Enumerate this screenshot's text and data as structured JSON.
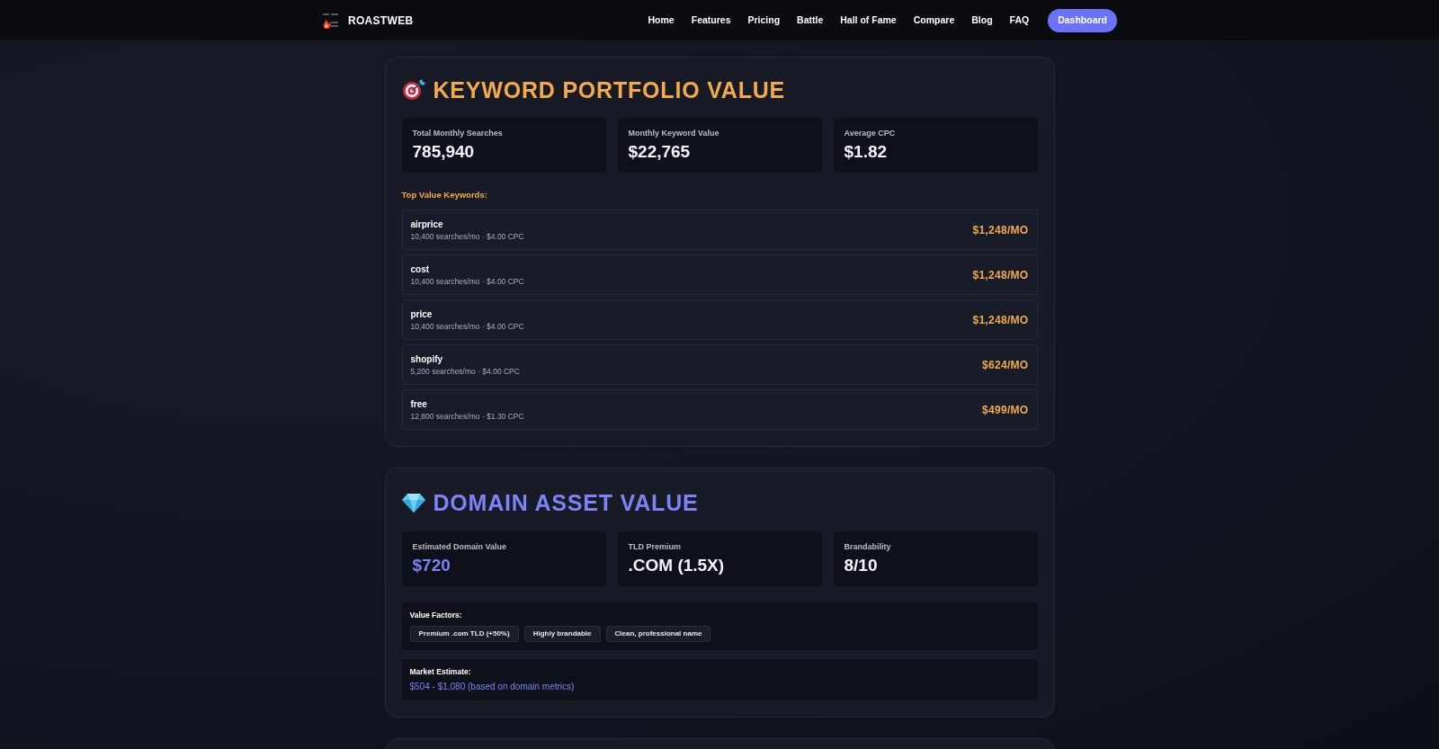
{
  "nav": {
    "brand": "ROASTWEB",
    "links": [
      "Home",
      "Features",
      "Pricing",
      "Battle",
      "Hall of Fame",
      "Compare",
      "Blog",
      "FAQ"
    ],
    "cta": "Dashboard"
  },
  "keyword_section": {
    "title": "KEYWORD PORTFOLIO VALUE",
    "stats": [
      {
        "label": "Total Monthly Searches",
        "value": "785,940"
      },
      {
        "label": "Monthly Keyword Value",
        "value": "$22,765"
      },
      {
        "label": "Average CPC",
        "value": "$1.82"
      }
    ],
    "list_title": "Top Value Keywords:",
    "keywords": [
      {
        "keyword": "airprice",
        "details": "10,400 searches/mo · $4.00 CPC",
        "value": "$1,248/MO"
      },
      {
        "keyword": "cost",
        "details": "10,400 searches/mo · $4.00 CPC",
        "value": "$1,248/MO"
      },
      {
        "keyword": "price",
        "details": "10,400 searches/mo · $4.00 CPC",
        "value": "$1,248/MO"
      },
      {
        "keyword": "shopify",
        "details": "5,200 searches/mo · $4.00 CPC",
        "value": "$624/MO"
      },
      {
        "keyword": "free",
        "details": "12,800 searches/mo · $1.30 CPC",
        "value": "$499/MO"
      }
    ]
  },
  "domain_section": {
    "title": "DOMAIN ASSET VALUE",
    "stats": [
      {
        "label": "Estimated Domain Value",
        "value": "$720",
        "highlighted": true
      },
      {
        "label": "TLD Premium",
        "value": ".COM (1.5X)",
        "highlighted": false
      },
      {
        "label": "Brandability",
        "value": "8/10",
        "highlighted": false
      }
    ],
    "factors_title": "Value Factors:",
    "factors": [
      "Premium .com TLD (+50%)",
      "Highly brandable",
      "Clean, professional name"
    ],
    "market_label": "Market Estimate:",
    "market_value": "$504 - $1,080 (based on domain metrics)"
  }
}
